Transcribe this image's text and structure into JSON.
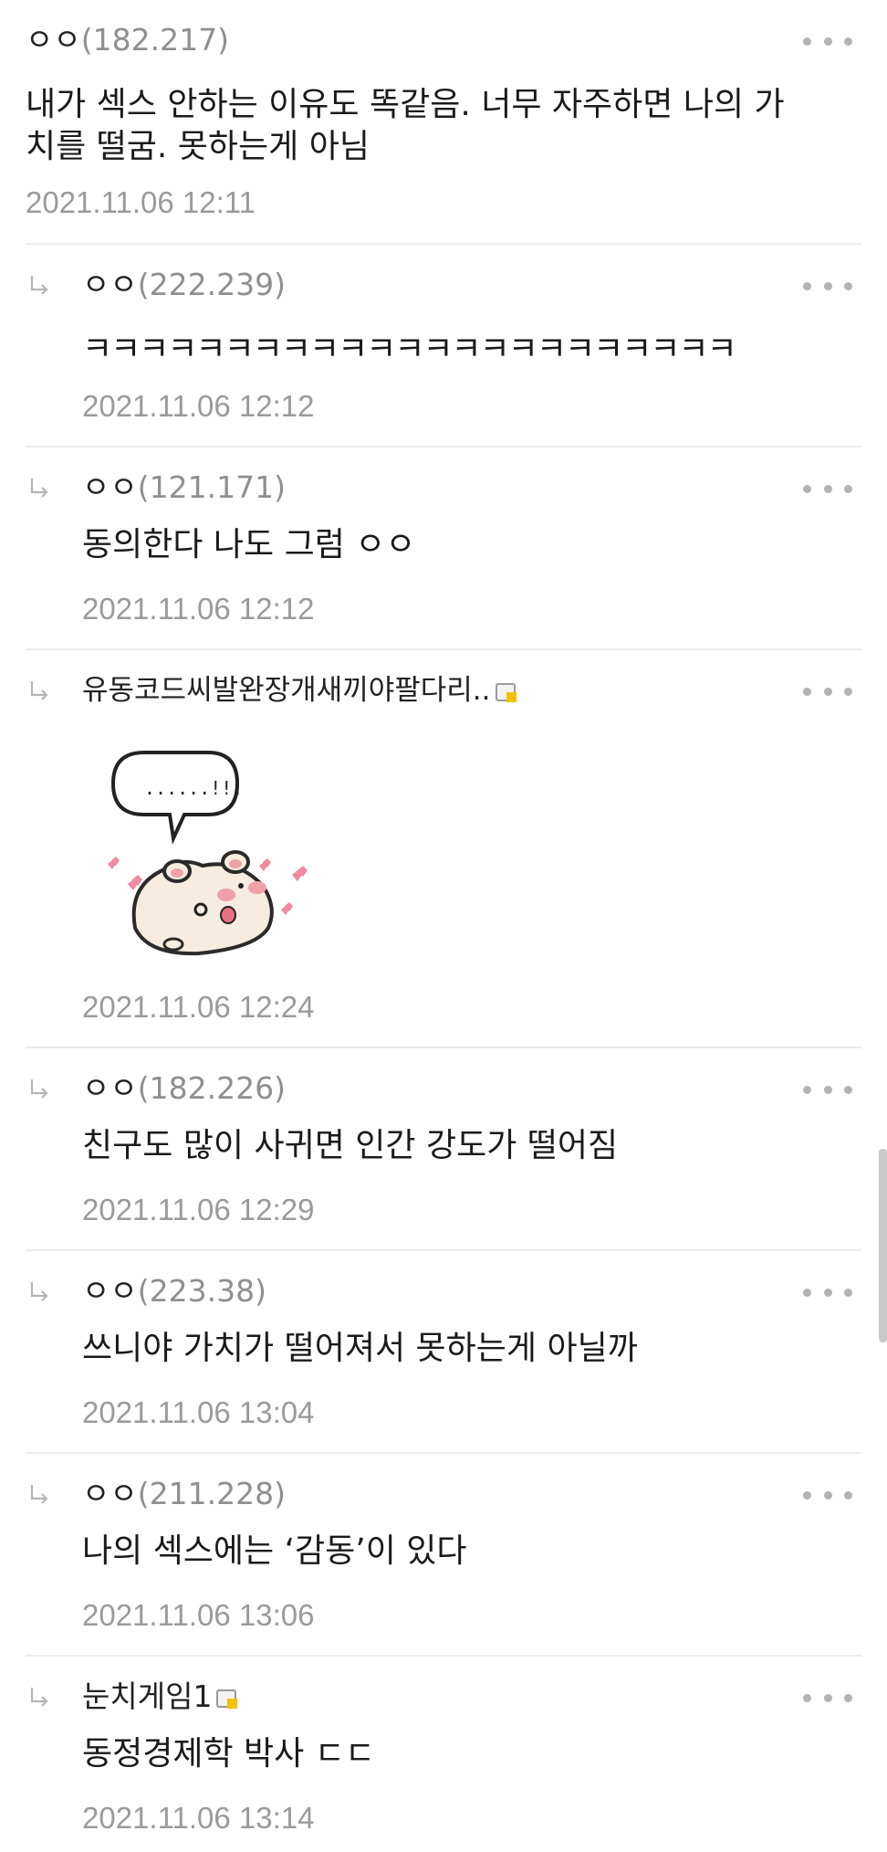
{
  "comments": [
    {
      "nick": "ㅇㅇ",
      "ip": "(182.217)",
      "body": "내가 섹스 안하는 이유도 똑같음. 너무 자주하면 나의 가치를 떨굼. 못하는게 아님",
      "date": "2021.11.06 12:11"
    },
    {
      "nick": "ㅇㅇ",
      "ip": "(222.239)",
      "body": "ㅋㅋㅋㅋㅋㅋㅋㅋㅋㅋㅋㅋㅋㅋㅋㅋㅋㅋㅋㅋㅋㅋㅋ",
      "date": "2021.11.06 12:12"
    },
    {
      "nick": "ㅇㅇ",
      "ip": "(121.171)",
      "body": "동의한다 나도 그럼 ㅇㅇ",
      "date": "2021.11.06 12:12"
    },
    {
      "nick": "유동코드씨발완장개새끼야팔다리..",
      "sticker_text": "......!!!",
      "date": "2021.11.06 12:24"
    },
    {
      "nick": "ㅇㅇ",
      "ip": "(182.226)",
      "body": "친구도 많이 사귀면 인간 강도가 떨어짐",
      "date": "2021.11.06 12:29"
    },
    {
      "nick": "ㅇㅇ",
      "ip": "(223.38)",
      "body": "쓰니야 가치가 떨어져서 못하는게 아닐까",
      "date": "2021.11.06 13:04"
    },
    {
      "nick": "ㅇㅇ",
      "ip": "(211.228)",
      "body": "나의 섹스에는 ‘감동’이 있다",
      "date": "2021.11.06 13:06"
    },
    {
      "nick": "눈치게임1",
      "body": "동정경제학 박사 ㄷㄷ",
      "date": "2021.11.06 13:14"
    }
  ],
  "icons": {
    "reply": "reply-arrow-icon",
    "more": "more-options-icon",
    "member": "member-badge-icon"
  },
  "colors": {
    "ip": "#8f8f8f",
    "date": "#9a9a9a",
    "divider": "#ececec"
  }
}
